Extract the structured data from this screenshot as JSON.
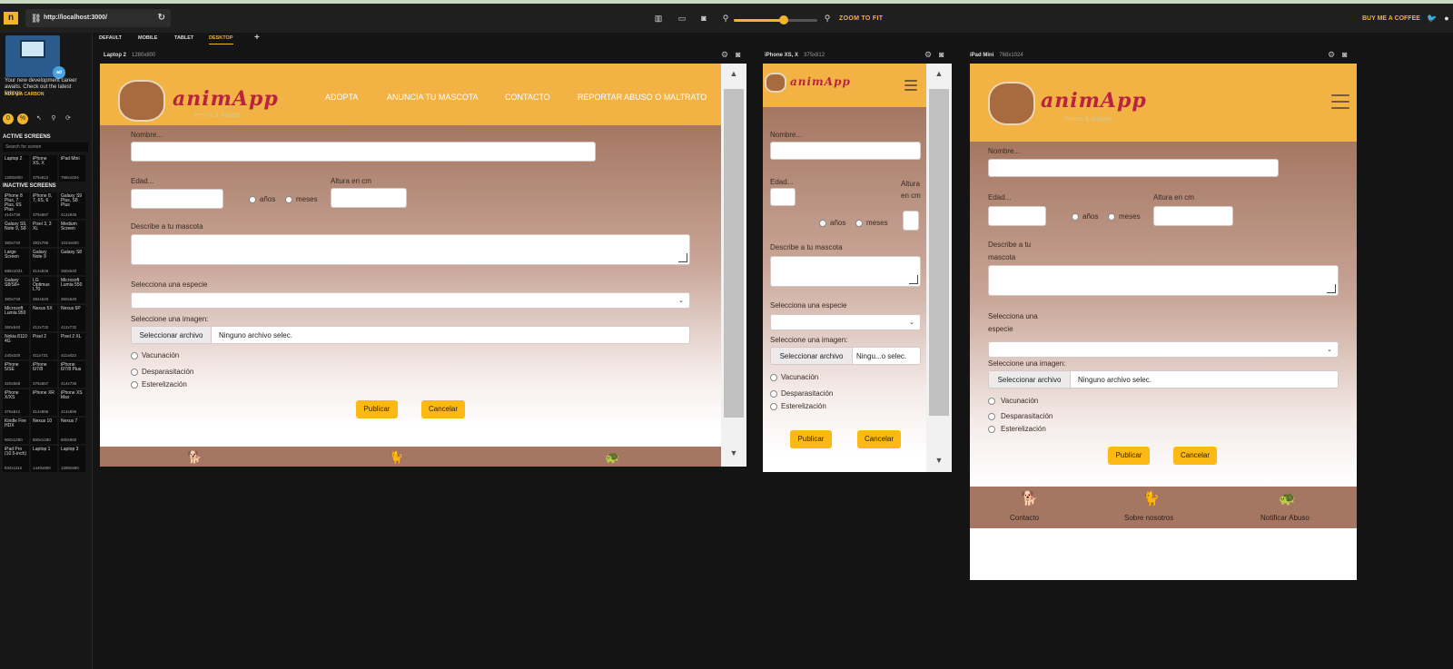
{
  "toolbar": {
    "url": "http://localhost:3000/",
    "zoom_fit_label": "ZOOM TO FIT",
    "coffee_label": "BUY ME A COFFEE",
    "zoom_level": 0.6
  },
  "sidebar": {
    "ad_text": "Your new development career awaits. Check out the latest listings.",
    "ad_link": "ADS VIA CARBON",
    "active_heading": "ACTIVE SCREENS",
    "search_placeholder": "Search for screen",
    "inactive_heading": "INACTIVE SCREENS",
    "active_screens": [
      {
        "name": "Laptop 2",
        "dim": "1280x800"
      },
      {
        "name": "iPhone XS, X",
        "dim": "375x812"
      },
      {
        "name": "iPad Mini",
        "dim": "768x1024"
      }
    ],
    "inactive_screens": [
      {
        "name": "iPhone 8 Plus, 7 Plus, 6S Plus",
        "dim": "414x736"
      },
      {
        "name": "iPhone 8, 7, 6S, 6",
        "dim": "375x667"
      },
      {
        "name": "Galaxy S9 Plus, S8 Plus",
        "dim": "412x846"
      },
      {
        "name": "Galaxy S9, Note 9, S8",
        "dim": "360x740"
      },
      {
        "name": "Pixel 3, 3 XL",
        "dim": "393x786"
      },
      {
        "name": "Medium Screen",
        "dim": "1024x600"
      },
      {
        "name": "Large Screen",
        "dim": "686x1031"
      },
      {
        "name": "Galaxy Note 9",
        "dim": "414x846"
      },
      {
        "name": "Galaxy S8",
        "dim": "360x640"
      },
      {
        "name": "Galaxy S8/S8+",
        "dim": "360x740"
      },
      {
        "name": "LG Optimus L70",
        "dim": "384x640"
      },
      {
        "name": "Microsoft Lumia 550",
        "dim": "360x640"
      },
      {
        "name": "Microsoft Lumia 950",
        "dim": "360x640"
      },
      {
        "name": "Nexus 5X",
        "dim": "412x732"
      },
      {
        "name": "Nexus 6P",
        "dim": "412x732"
      },
      {
        "name": "Nokia 8110 4G",
        "dim": "240x320"
      },
      {
        "name": "Pixel 2",
        "dim": "411x731"
      },
      {
        "name": "Pixel 2 XL",
        "dim": "411x823"
      },
      {
        "name": "iPhone 5/SE",
        "dim": "320x568"
      },
      {
        "name": "iPhone 6/7/8",
        "dim": "375x667"
      },
      {
        "name": "iPhone 6/7/8 Plus",
        "dim": "414x736"
      },
      {
        "name": "iPhone X/XS",
        "dim": "375x812"
      },
      {
        "name": "iPhone XR",
        "dim": "414x896"
      },
      {
        "name": "iPhone XS Max",
        "dim": "414x896"
      },
      {
        "name": "Kindle Fire HDX",
        "dim": "800x1280"
      },
      {
        "name": "Nexus 10",
        "dim": "800x1280"
      },
      {
        "name": "Nexus 7",
        "dim": "600x960"
      },
      {
        "name": "iPad Pro (10.5-inch)",
        "dim": "834x1112"
      },
      {
        "name": "Laptop 1",
        "dim": "1440x900"
      },
      {
        "name": "Laptop 3",
        "dim": "1280x950"
      }
    ]
  },
  "tabs": [
    "DEFAULT",
    "MOBILE",
    "TABLET",
    "DESKTOP"
  ],
  "devices": {
    "laptop": {
      "name": "Laptop 2",
      "dim": "1280x800"
    },
    "iphone": {
      "name": "iPhone XS, X",
      "dim": "375x812"
    },
    "ipad": {
      "name": "iPad Mini",
      "dim": "768x1024"
    }
  },
  "site": {
    "brand": "animApp",
    "tagline": "Perros & Adopta",
    "nav": [
      "ADOPTA",
      "ANUNCIA TU MASCOTA",
      "CONTACTO",
      "REPORTAR ABUSO O MALTRATO"
    ],
    "form": {
      "nombre": "Nombre...",
      "edad": "Edad...",
      "anios": "años",
      "meses": "meses",
      "altura": "Altura en cm",
      "describe": "Describe a tu mascota",
      "especie": "Selecciona una especie",
      "imagen": "Seleccione una imagen:",
      "file_button": "Seleccionar archivo",
      "file_status": "Ninguno archivo selec.",
      "file_status_short": "Ningu...o selec.",
      "vacunacion": "Vacunación",
      "desparasitacion": "Desparasitación",
      "esterelizacion": "Esterelización",
      "publicar": "Publicar",
      "cancelar": "Cancelar"
    },
    "footer": [
      "Contacto",
      "Sobre nosotros",
      "Notificar Abuso"
    ]
  }
}
